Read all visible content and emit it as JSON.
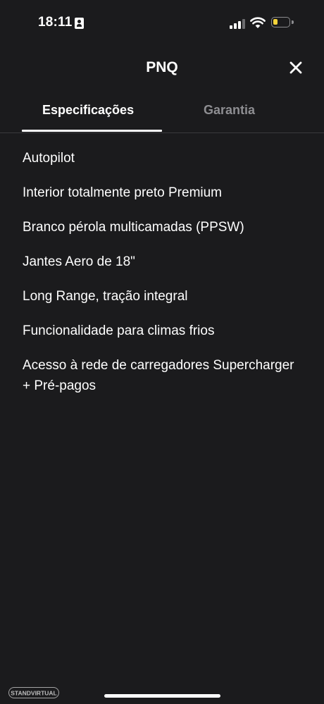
{
  "status_bar": {
    "time": "18:11",
    "battery_level": 0.3
  },
  "header": {
    "title": "PNQ"
  },
  "tabs": [
    {
      "label": "Especificações",
      "active": true
    },
    {
      "label": "Garantia",
      "active": false
    }
  ],
  "specs": [
    "Autopilot",
    "Interior totalmente preto Premium",
    "Branco pérola multicamadas (PPSW)",
    "Jantes Aero de 18\"",
    "Long Range, tração integral",
    "Funcionalidade para climas frios",
    "Acesso à rede de carregadores Supercharger + Pré-pagos"
  ],
  "watermark": {
    "text": "STANDVIRTUAL"
  },
  "colors": {
    "background": "#1b1b1d",
    "text": "#ffffff",
    "inactive_tab": "#8e8e92",
    "battery": "#f4d33a"
  }
}
